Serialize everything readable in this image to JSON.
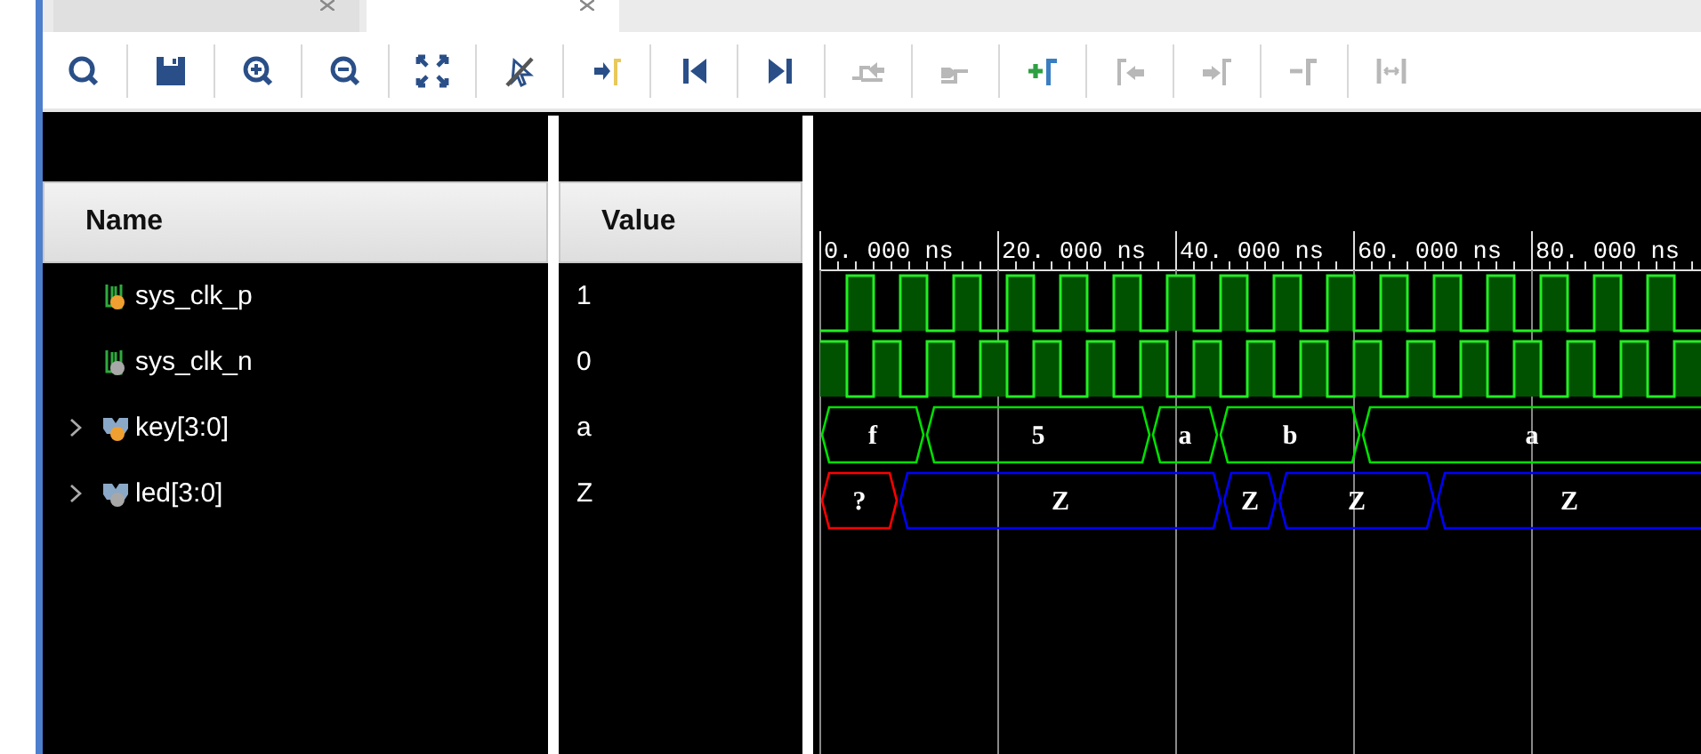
{
  "tabs": [
    {
      "selected": false
    },
    {
      "selected": true
    }
  ],
  "toolbar": [
    {
      "kind": "search",
      "disabled": false
    },
    {
      "kind": "save",
      "disabled": false
    },
    {
      "kind": "zoom-in",
      "disabled": false
    },
    {
      "kind": "zoom-out",
      "disabled": false
    },
    {
      "kind": "fit",
      "disabled": false
    },
    {
      "kind": "cursor-off",
      "disabled": false
    },
    {
      "kind": "goto-cursor",
      "disabled": false
    },
    {
      "kind": "go-start",
      "disabled": false
    },
    {
      "kind": "go-end",
      "disabled": false
    },
    {
      "kind": "prev-edge",
      "disabled": true
    },
    {
      "kind": "next-edge",
      "disabled": true
    },
    {
      "kind": "add-marker",
      "disabled": false
    },
    {
      "kind": "prev-marker",
      "disabled": true
    },
    {
      "kind": "next-marker",
      "disabled": true
    },
    {
      "kind": "remove-marker",
      "disabled": true
    },
    {
      "kind": "swap",
      "disabled": true
    }
  ],
  "columns": [
    "Name",
    "Value"
  ],
  "rows": [
    {
      "name": "sys_clk_p",
      "value": "1",
      "kind": "scalar",
      "color": "#f0a030"
    },
    {
      "name": "sys_clk_n",
      "value": "0",
      "kind": "scalar",
      "color": "#a8a8a8"
    },
    {
      "name": "key[3:0]",
      "value": "a",
      "kind": "bus",
      "color": "#f0a030"
    },
    {
      "name": "led[3:0]",
      "value": "Z",
      "kind": "bus",
      "color": "#a8a8a8"
    }
  ],
  "ruler": [
    "0. 000 ns",
    "20. 000 ns",
    "40. 000 ns",
    "60. 000 ns",
    "80. 000 ns"
  ],
  "traces": [
    {
      "kind": "clock",
      "starts_high": false
    },
    {
      "kind": "clock",
      "starts_high": true
    },
    {
      "kind": "bus",
      "segments": [
        {
          "text": "f",
          "color": "#00e000"
        },
        {
          "text": "5",
          "color": "#00e000"
        },
        {
          "text": "a",
          "color": "#00e000"
        },
        {
          "text": "b",
          "color": "#00e000"
        },
        {
          "text": "a",
          "color": "#00e000"
        }
      ]
    },
    {
      "kind": "bus",
      "segments": [
        {
          "text": "?",
          "color": "#ff0000"
        },
        {
          "text": "Z",
          "color": "#0000ff"
        },
        {
          "text": "Z",
          "color": "#0000ff"
        },
        {
          "text": "Z",
          "color": "#0000ff"
        },
        {
          "text": "Z",
          "color": "#0000ff"
        }
      ]
    }
  ]
}
